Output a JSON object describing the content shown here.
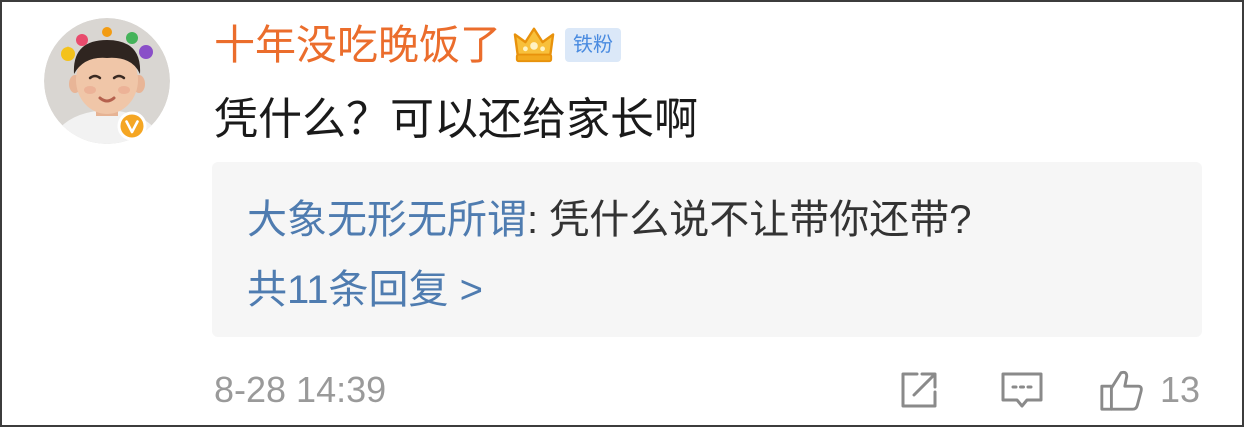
{
  "colors": {
    "username": "#eb6d2c",
    "link_blue": "#4f7cb0",
    "body_text": "#1a1a1a",
    "reply_text": "#333333",
    "meta_gray": "#9a9a9a",
    "reply_bg": "#f6f6f6",
    "fan_badge_bg": "#dbe8f8",
    "fan_badge_text": "#4a8be0",
    "verified_badge": "#f5a623",
    "icon_gray": "#8a8a8a"
  },
  "comment": {
    "avatar_icon": "avatar-photo",
    "verified_badge_icon": "verified-v-icon",
    "username": "十年没吃晚饭了",
    "member_icon": "crown-icon",
    "fan_badge": "铁粉",
    "text": "凭什么？可以还给家长啊",
    "reply_preview": {
      "author": "大象无形无所谓",
      "text": ": 凭什么说不让带你还带?",
      "more_link": "共11条回复 >"
    },
    "timestamp": "8-28 14:39",
    "actions": {
      "share_icon": "share-icon",
      "comment_icon": "comment-icon",
      "like_icon": "thumbs-up-icon",
      "like_count": "13"
    }
  }
}
